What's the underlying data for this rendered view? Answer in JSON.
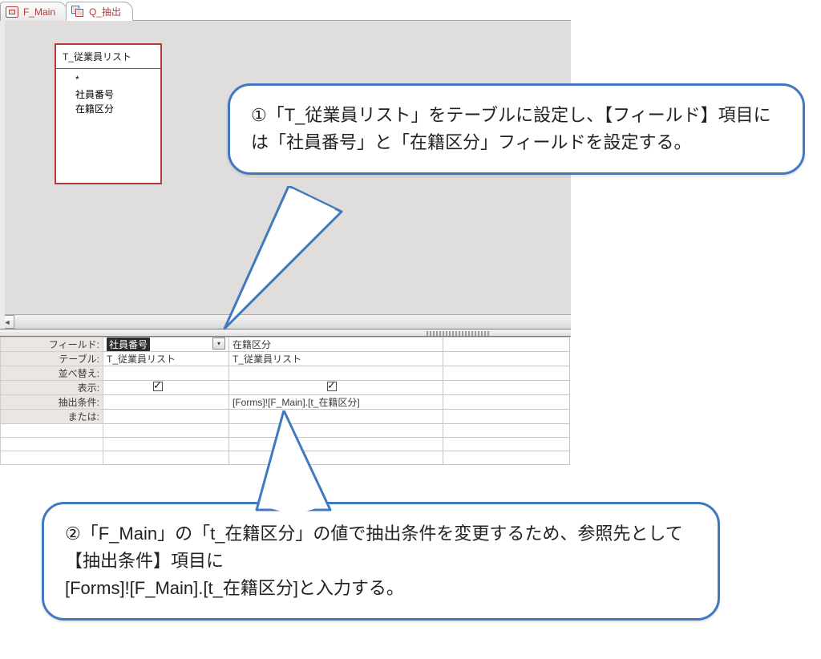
{
  "tabs": [
    {
      "label": "F_Main",
      "type": "form",
      "active": false
    },
    {
      "label": "Q_抽出",
      "type": "query",
      "active": true
    }
  ],
  "table_card": {
    "title": "T_従業員リスト",
    "fields": [
      "*",
      "社員番号",
      "在籍区分"
    ]
  },
  "qbe": {
    "row_labels": {
      "field": "フィールド:",
      "table": "テーブル:",
      "sort": "並べ替え:",
      "show": "表示:",
      "criteria": "抽出条件:",
      "or": "または:"
    },
    "columns": [
      {
        "field": "社員番号",
        "field_selected": true,
        "has_dropdown": true,
        "table": "T_従業員リスト",
        "sort": "",
        "show": true,
        "criteria": "",
        "or": ""
      },
      {
        "field": "在籍区分",
        "field_selected": false,
        "has_dropdown": false,
        "table": "T_従業員リスト",
        "sort": "",
        "show": true,
        "criteria": "[Forms]![F_Main].[t_在籍区分]",
        "or": ""
      }
    ]
  },
  "annotations": {
    "a1": "①「T_従業員リスト」をテーブルに設定し、【フィールド】項目には「社員番号」と「在籍区分」フィールドを設定する。",
    "a2": "②「F_Main」の「t_在籍区分」の値で抽出条件を変更するため、参照先として\n【抽出条件】項目に\n[Forms]![F_Main].[t_在籍区分]と入力する。"
  },
  "colors": {
    "tab_accent": "#b53a3a",
    "callout_border": "#4179c0",
    "pane_bg": "#e0dedc"
  }
}
